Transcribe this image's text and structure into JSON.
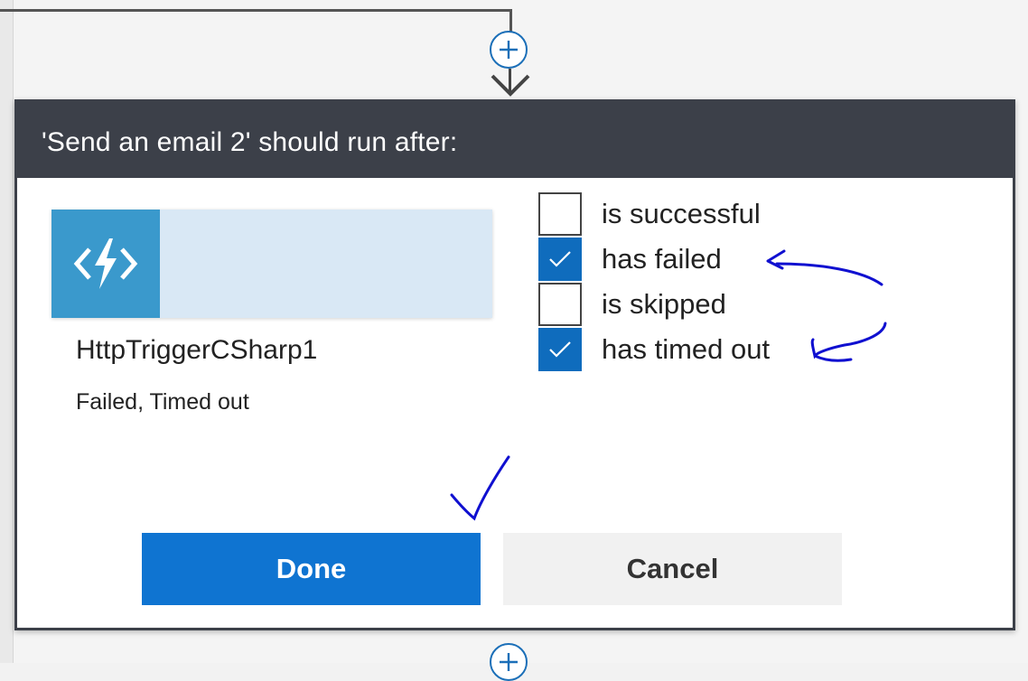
{
  "dialog": {
    "title": "'Send an email 2' should run after:"
  },
  "action": {
    "name": "HttpTriggerCSharp1",
    "status": "Failed, Timed out",
    "icon": "azure-function-icon"
  },
  "conditions": [
    {
      "label": "is successful",
      "checked": false
    },
    {
      "label": "has failed",
      "checked": true
    },
    {
      "label": "is skipped",
      "checked": false
    },
    {
      "label": "has timed out",
      "checked": true
    }
  ],
  "buttons": {
    "done": "Done",
    "cancel": "Cancel"
  },
  "colors": {
    "header": "#3c4049",
    "accent": "#0f74d1",
    "card_icon": "#3a99cc",
    "card_body": "#d9e8f5",
    "annotation": "#1010d0"
  }
}
